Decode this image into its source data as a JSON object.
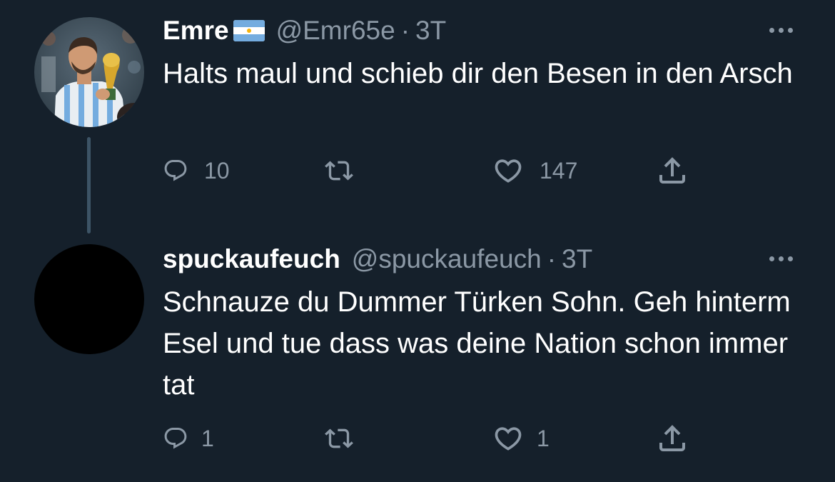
{
  "colors": {
    "background": "#15202b",
    "text_primary": "#ffffff",
    "text_secondary": "#8b98a5",
    "thread_line": "#3d5466",
    "flag_blue": "#74acdf",
    "flag_sun": "#f6b40e"
  },
  "tweets": [
    {
      "display_name": "Emre",
      "flag_icon": "argentina-flag-icon",
      "handle": "@Emr65e",
      "separator": "·",
      "time": "3T",
      "more_icon": "more-options-icon",
      "text": "Halts maul und schieb dir den Besen in den Arsch",
      "avatar_icon": "messi-trophy-avatar",
      "reply_count": "10",
      "retweet_count": "",
      "like_count": "147"
    },
    {
      "display_name": "spuckaufeuch",
      "handle": "@spuckaufeuch",
      "separator": "·",
      "time": "3T",
      "more_icon": "more-options-icon",
      "text": "Schnauze du Dummer Türken Sohn. Geh hinterm Esel und tue dass was deine Nation schon immer tat",
      "avatar_icon": "black-avatar",
      "reply_count": "1",
      "retweet_count": "",
      "like_count": "1"
    }
  ],
  "action_icons": [
    "reply-icon",
    "retweet-icon",
    "like-icon",
    "share-icon"
  ]
}
